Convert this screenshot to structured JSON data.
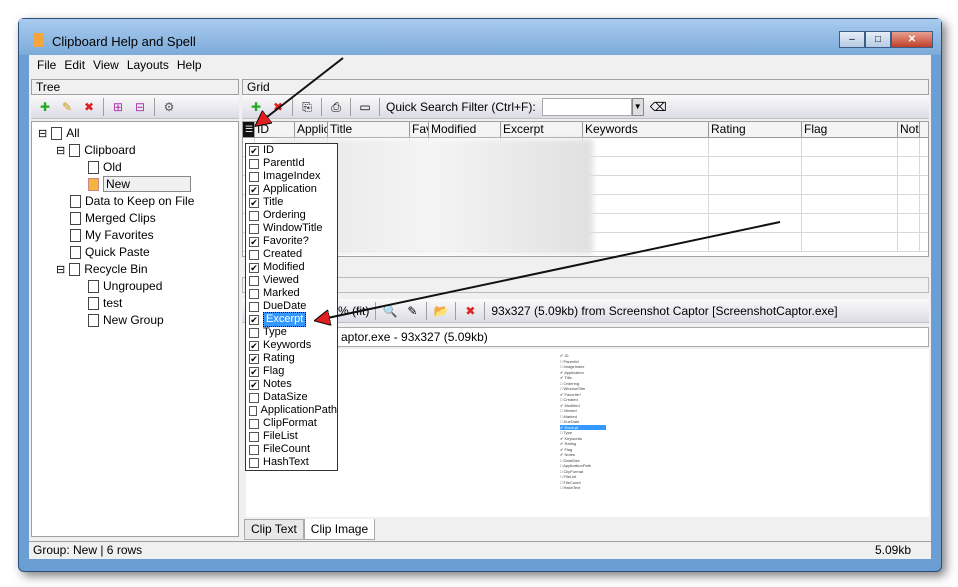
{
  "window": {
    "title": "Clipboard Help and Spell",
    "min": "–",
    "max": "□",
    "close": "✕"
  },
  "menu": [
    "File",
    "Edit",
    "View",
    "Layouts",
    "Help"
  ],
  "tree_pane": {
    "header": "Tree",
    "nodes": [
      {
        "label": "All",
        "level": 0,
        "expander": "⊟"
      },
      {
        "label": "Clipboard",
        "level": 1,
        "expander": "⊟"
      },
      {
        "label": "Old",
        "level": 2
      },
      {
        "label": "New",
        "level": 2,
        "selected": true
      },
      {
        "label": "Data to Keep on File",
        "level": 1
      },
      {
        "label": "Merged Clips",
        "level": 1
      },
      {
        "label": "My Favorites",
        "level": 1
      },
      {
        "label": "Quick Paste",
        "level": 1
      },
      {
        "label": "Recycle Bin",
        "level": 1,
        "expander": "⊟"
      },
      {
        "label": "Ungrouped",
        "level": 2
      },
      {
        "label": "test",
        "level": 2
      },
      {
        "label": "New Group",
        "level": 2
      }
    ]
  },
  "grid_pane": {
    "header": "Grid",
    "search_label": "Quick Search Filter (Ctrl+F):",
    "search_value": "",
    "columns": [
      "ID",
      "Applic",
      "Title",
      "Fav",
      "Modified",
      "Excerpt",
      "Keywords",
      "Rating",
      "Flag",
      "Not"
    ]
  },
  "column_menu": [
    {
      "label": "ID",
      "checked": true
    },
    {
      "label": "ParentId",
      "checked": false
    },
    {
      "label": "ImageIndex",
      "checked": false
    },
    {
      "label": "Application",
      "checked": true
    },
    {
      "label": "Title",
      "checked": true
    },
    {
      "label": "Ordering",
      "checked": false
    },
    {
      "label": "WindowTitle",
      "checked": false
    },
    {
      "label": "Favorite?",
      "checked": true
    },
    {
      "label": "Created",
      "checked": false
    },
    {
      "label": "Modified",
      "checked": true
    },
    {
      "label": "Viewed",
      "checked": false
    },
    {
      "label": "Marked",
      "checked": false
    },
    {
      "label": "DueDate",
      "checked": false
    },
    {
      "label": "Excerpt",
      "checked": true,
      "selected": true
    },
    {
      "label": "Type",
      "checked": false
    },
    {
      "label": "Keywords",
      "checked": true
    },
    {
      "label": "Rating",
      "checked": true
    },
    {
      "label": "Flag",
      "checked": true
    },
    {
      "label": "Notes",
      "checked": true
    },
    {
      "label": "DataSize",
      "checked": false
    },
    {
      "label": "ApplicationPath",
      "checked": false
    },
    {
      "label": "ClipFormat",
      "checked": false
    },
    {
      "label": "FileList",
      "checked": false
    },
    {
      "label": "FileCount",
      "checked": false
    },
    {
      "label": "HashText",
      "checked": false
    }
  ],
  "clip_pane": {
    "zoom": "% (fit)",
    "info": "93x327  (5.09kb) from Screenshot Captor [ScreenshotCaptor.exe]",
    "caption": "aptor.exe - 93x327  (5.09kb)",
    "tabs": [
      {
        "label": "Clip Text"
      },
      {
        "label": "Clip Image",
        "active": true
      }
    ]
  },
  "status": {
    "left": "Group:  New  |  6 rows",
    "right": "5.09kb"
  },
  "colors": {
    "frame": "#6b9fd3",
    "selection": "#3399ff",
    "arrow": "#e02020"
  }
}
